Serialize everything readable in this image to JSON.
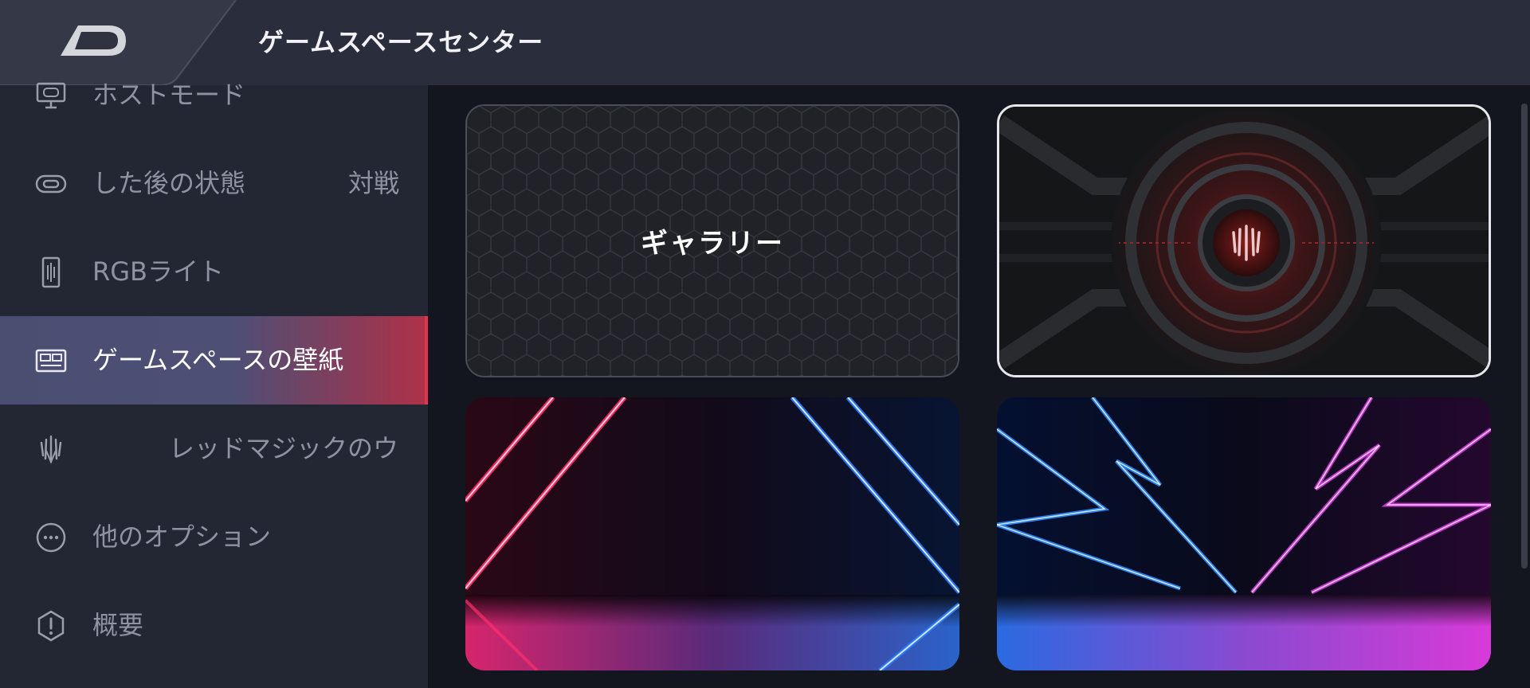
{
  "header": {
    "title": "ゲームスペースセンター",
    "back_icon": "back-arrow-icon"
  },
  "sidebar": {
    "items": [
      {
        "label": "ホストモード",
        "value": "",
        "icon": "monitor-gamepad-icon",
        "active": false
      },
      {
        "label": "した後の状態",
        "value": "対戦",
        "icon": "toggle-icon",
        "active": false
      },
      {
        "label": "RGBライト",
        "value": "",
        "icon": "light-bar-icon",
        "active": false
      },
      {
        "label": "ゲームスペースの壁紙",
        "value": "",
        "icon": "wallpaper-icon",
        "active": true
      },
      {
        "label": "レッドマジックのウ",
        "value": "",
        "icon": "red-magic-logo-icon",
        "active": false
      },
      {
        "label": "他のオプション",
        "value": "",
        "icon": "more-options-icon",
        "active": false
      },
      {
        "label": "概要",
        "value": "",
        "icon": "info-icon",
        "active": false
      }
    ]
  },
  "wallpapers": {
    "gallery_label": "ギャラリー",
    "items": [
      {
        "name": "wallpaper-red-magic-core",
        "selected": true
      },
      {
        "name": "wallpaper-neon-red-blue",
        "selected": false
      },
      {
        "name": "wallpaper-neon-blue-purple",
        "selected": false
      }
    ]
  },
  "colors": {
    "accent": "#e0344f",
    "header_bg": "#2a2d3b",
    "sidebar_bg": "#232633",
    "content_bg": "#13161f",
    "active_bg": "#4a4f72"
  }
}
